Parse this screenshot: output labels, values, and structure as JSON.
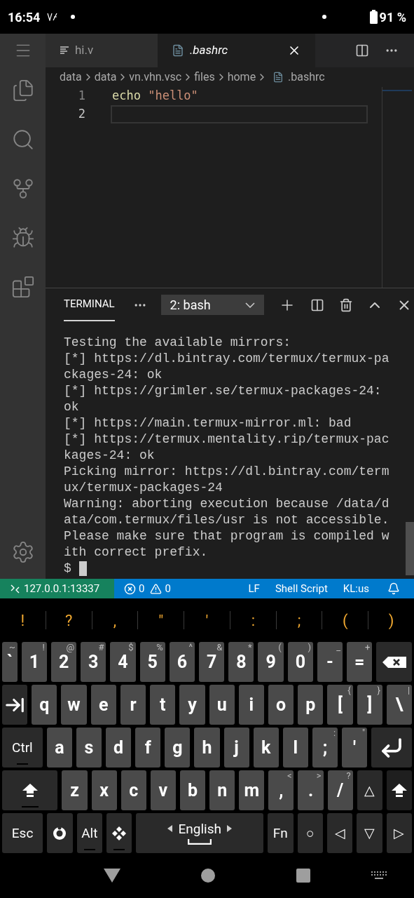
{
  "phone_status": {
    "time": "16:54",
    "battery": "91 %"
  },
  "editor": {
    "tabs": [
      {
        "label": "hi.v",
        "selected": false,
        "italic": false
      },
      {
        "label": ".bashrc",
        "selected": true,
        "italic": true
      }
    ],
    "breadcrumb": [
      "data",
      "data",
      "vn.vhn.vsc",
      "files",
      "home",
      ".bashrc"
    ],
    "lines": [
      {
        "number": "1",
        "tokens": [
          {
            "text": "echo",
            "kind": "command"
          },
          {
            "text": "\"hello\"",
            "kind": "string"
          }
        ],
        "current": false
      },
      {
        "number": "2",
        "current": true
      }
    ]
  },
  "panel": {
    "tab": {
      "label": "TERMINAL",
      "selected": true
    },
    "terminal_selector": "2: bash",
    "lines": [
      "Testing the available mirrors:",
      "[*] https://dl.bintray.com/termux/termux-pa",
      "ckages-24: ok",
      "[*] https://grimler.se/termux-packages-24:",
      "ok",
      "[*] https://main.termux-mirror.ml: bad",
      "[*] https://termux.mentality.rip/termux-pac",
      "kages-24: ok",
      "Picking mirror: https://dl.bintray.com/term",
      "ux/termux-packages-24",
      "Warning: aborting execution because /data/d",
      "ata/com.termux/files/usr is not accessible.",
      "Please make sure that program is compiled w",
      "ith correct prefix."
    ],
    "prompt": "$"
  },
  "status_bar": {
    "remote": "127.0.0.1:13337",
    "errors": "0",
    "warnings": "0",
    "items": [
      "LF",
      "Shell Script",
      "KL:us"
    ]
  },
  "extra_keys": [
    "!",
    "?",
    ",",
    "\"",
    "'",
    ":",
    ";",
    "(",
    ")"
  ],
  "keyboard": [
    [
      {
        "kind": "narrow",
        "label": "`",
        "alt": "~"
      },
      {
        "kind": "char",
        "label": "1",
        "alt": "!"
      },
      {
        "kind": "char",
        "label": "2",
        "alt": "@"
      },
      {
        "kind": "char",
        "label": "3",
        "alt": "#"
      },
      {
        "kind": "char",
        "label": "4",
        "alt": "$"
      },
      {
        "kind": "char",
        "label": "5",
        "alt": "%"
      },
      {
        "kind": "char",
        "label": "6",
        "alt": "^"
      },
      {
        "kind": "char",
        "label": "7",
        "alt": "&"
      },
      {
        "kind": "char",
        "label": "8",
        "alt": "*"
      },
      {
        "kind": "char",
        "label": "9",
        "alt": "("
      },
      {
        "kind": "char",
        "label": "0",
        "alt": ")"
      },
      {
        "kind": "char",
        "label": "-",
        "alt": "_"
      },
      {
        "kind": "char",
        "label": "=",
        "alt": "+"
      },
      {
        "kind": "backspace"
      }
    ],
    [
      {
        "kind": "tab"
      },
      {
        "kind": "char",
        "label": "q"
      },
      {
        "kind": "char",
        "label": "w"
      },
      {
        "kind": "char",
        "label": "e"
      },
      {
        "kind": "char",
        "label": "r"
      },
      {
        "kind": "char",
        "label": "t"
      },
      {
        "kind": "char",
        "label": "y"
      },
      {
        "kind": "char",
        "label": "u"
      },
      {
        "kind": "char",
        "label": "i"
      },
      {
        "kind": "char",
        "label": "o"
      },
      {
        "kind": "char",
        "label": "p"
      },
      {
        "kind": "char",
        "label": "[",
        "alt": "{"
      },
      {
        "kind": "char",
        "label": "]",
        "alt": "}"
      },
      {
        "kind": "char",
        "label": "\\",
        "alt": "|"
      }
    ],
    [
      {
        "kind": "wide",
        "label": "Ctrl",
        "latch": true
      },
      {
        "kind": "char",
        "label": "a"
      },
      {
        "kind": "char",
        "label": "s"
      },
      {
        "kind": "char",
        "label": "d"
      },
      {
        "kind": "char",
        "label": "f"
      },
      {
        "kind": "char",
        "label": "g"
      },
      {
        "kind": "char",
        "label": "h"
      },
      {
        "kind": "char",
        "label": "j"
      },
      {
        "kind": "char",
        "label": "k"
      },
      {
        "kind": "char",
        "label": "l"
      },
      {
        "kind": "char",
        "label": ";",
        "alt": ":"
      },
      {
        "kind": "char",
        "label": "'",
        "alt": "\""
      },
      {
        "kind": "enter"
      }
    ],
    [
      {
        "kind": "bigshift"
      },
      {
        "kind": "char",
        "label": "z"
      },
      {
        "kind": "char",
        "label": "x"
      },
      {
        "kind": "char",
        "label": "c"
      },
      {
        "kind": "char",
        "label": "v"
      },
      {
        "kind": "char",
        "label": "b"
      },
      {
        "kind": "char",
        "label": "n"
      },
      {
        "kind": "char",
        "label": "m"
      },
      {
        "kind": "char",
        "label": ",",
        "alt": "<"
      },
      {
        "kind": "char",
        "label": ".",
        "alt": ">"
      },
      {
        "kind": "char",
        "label": "/",
        "alt": "?"
      },
      {
        "kind": "fn",
        "label": "△"
      },
      {
        "kind": "shift"
      }
    ],
    [
      {
        "kind": "wide",
        "label": "Esc",
        "latch": false
      },
      {
        "kind": "gear"
      },
      {
        "kind": "fn",
        "label": "Alt",
        "latch": true
      },
      {
        "kind": "diamond"
      },
      {
        "kind": "space",
        "label": "English"
      },
      {
        "kind": "fn",
        "label": "Fn"
      },
      {
        "kind": "fn",
        "label": "○"
      },
      {
        "kind": "fn",
        "label": "◁"
      },
      {
        "kind": "fn",
        "label": "▽"
      },
      {
        "kind": "fn",
        "label": "▷"
      }
    ]
  ]
}
